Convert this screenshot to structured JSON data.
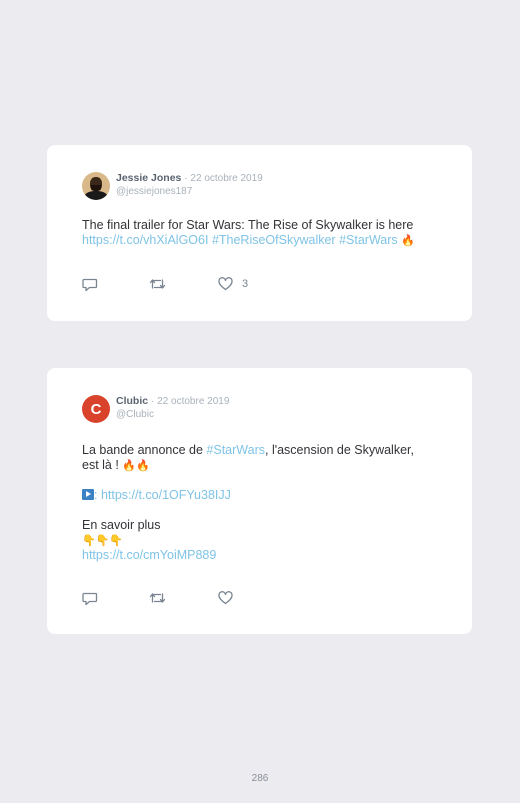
{
  "tweets": [
    {
      "author_name": "Jessie Jones",
      "date": "· 22 octobre 2019",
      "handle": "@jessiejones187",
      "text_plain": "The final trailer for Star Wars: The Rise of Skywalker is here",
      "link": "https://t.co/vhXiAlGO6I",
      "hashtag_1": "#TheRiseOfSkywalker",
      "hashtag_2": "#StarWars",
      "emoji": "🔥",
      "like_count": "3",
      "icons": [
        "reply-icon",
        "retweet-icon",
        "like-icon"
      ]
    },
    {
      "author_name": "Clubic",
      "date": "· 22 octobre 2019",
      "handle": "@Clubic",
      "avatar_letter": "C",
      "text_part_1": "La bande annonce de ",
      "hashtag": "#StarWars",
      "text_part_2": ", l'ascension de Skywalker,",
      "text_part_3": "est là ! ",
      "emoji_fire": "🔥🔥",
      "play_sep": ": ",
      "link_1": "https://t.co/1OFYu38IJJ",
      "more_text": "En savoir plus",
      "emoji_hands": "👇👇👇",
      "link_2": "https://t.co/cmYoiMP889",
      "icons": [
        "reply-icon",
        "retweet-icon",
        "like-icon"
      ]
    }
  ],
  "page_number": "286",
  "colors": {
    "background": "#ebebf0",
    "card": "#ffffff",
    "link": "#7fc3e6",
    "clubic_logo": "#d9432b"
  }
}
